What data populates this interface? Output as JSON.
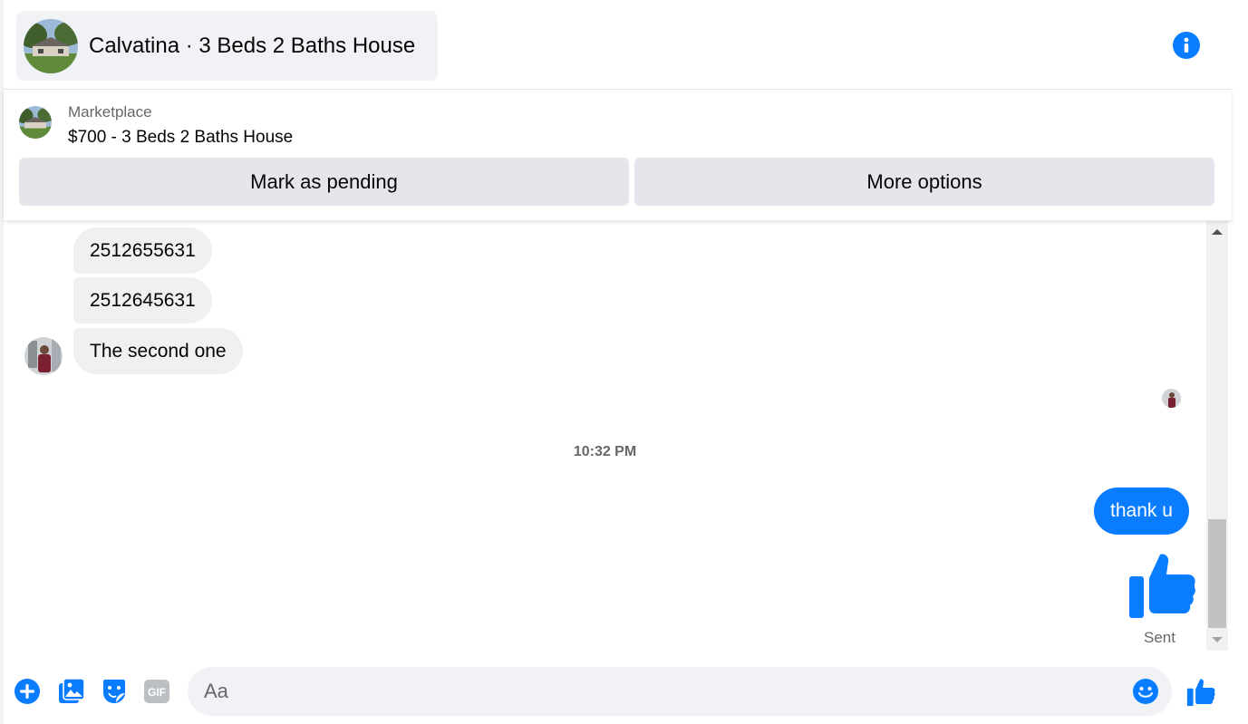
{
  "header": {
    "title": "Calvatina · 3 Beds 2 Baths House",
    "info_icon": "info-icon"
  },
  "marketplace": {
    "label": "Marketplace",
    "listing": "$700 - 3 Beds 2 Baths House",
    "mark_pending_label": "Mark as pending",
    "more_options_label": "More options"
  },
  "messages": {
    "incoming": [
      {
        "text": "2512655631"
      },
      {
        "text": "2512645631"
      },
      {
        "text": "The second one"
      }
    ],
    "timestamp": "10:32 PM",
    "outgoing": [
      {
        "text": "thank u"
      }
    ],
    "status": "Sent"
  },
  "composer": {
    "placeholder": "Aa",
    "icons": [
      "plus-icon",
      "photo-icon",
      "sticker-icon",
      "gif-icon",
      "emoji-icon",
      "like-icon"
    ]
  },
  "colors": {
    "accent": "#0a7cff",
    "bubble_in": "#f0f0f0",
    "button_bg": "#e4e6eb",
    "secondary_text": "#65676b"
  }
}
